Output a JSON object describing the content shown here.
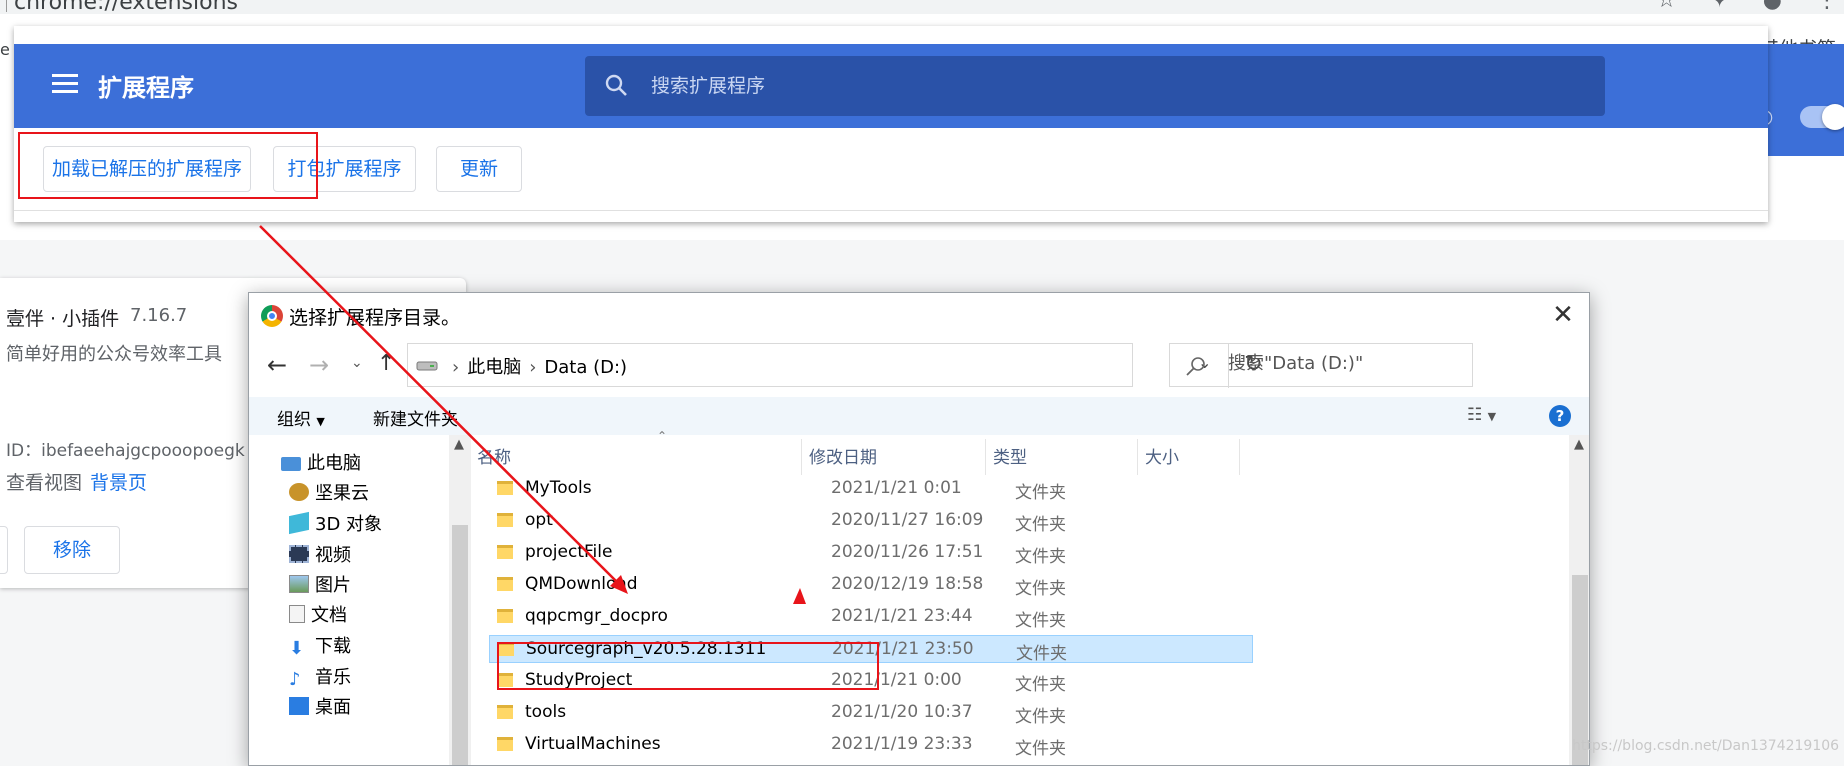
{
  "browser": {
    "url": "chrome://extensions",
    "bookmarks_other": "其他书签",
    "left_cut_text": "e"
  },
  "header": {
    "title": "扩展程序",
    "search_placeholder": "搜索扩展程序"
  },
  "toolbar": {
    "load_unpacked": "加载已解压的扩展程序",
    "pack": "打包扩展程序",
    "update": "更新"
  },
  "extension_card": {
    "name": "壹伴 · 小插件",
    "version": "7.16.7",
    "description": "简单好用的公众号效率工具",
    "id": "ID：ibefaeehajgcpooopoegk",
    "inspect_views": "查看视图",
    "background_page": "背景页",
    "remove": "移除"
  },
  "dialog": {
    "title": "选择扩展程序目录。",
    "address": {
      "crumbs": [
        "此电脑",
        "Data (D:)"
      ]
    },
    "search_placeholder": "搜索\"Data (D:)\"",
    "organize": "组织",
    "new_folder": "新建文件夹",
    "help": "?",
    "nav_pane": [
      {
        "label": "此电脑",
        "icon": "computer-icon"
      },
      {
        "label": "坚果云",
        "icon": "nutstore-icon"
      },
      {
        "label": "3D 对象",
        "icon": "3d-objects-icon"
      },
      {
        "label": "视频",
        "icon": "video-icon"
      },
      {
        "label": "图片",
        "icon": "pictures-icon"
      },
      {
        "label": "文档",
        "icon": "documents-icon"
      },
      {
        "label": "下载",
        "icon": "download-icon"
      },
      {
        "label": "音乐",
        "icon": "music-icon"
      },
      {
        "label": "桌面",
        "icon": "desktop-icon"
      }
    ],
    "columns": [
      "名称",
      "修改日期",
      "类型",
      "大小"
    ],
    "files": [
      {
        "name": "MyTools",
        "date": "2021/1/21 0:01",
        "type": "文件夹"
      },
      {
        "name": "opt",
        "date": "2020/11/27 16:09",
        "type": "文件夹"
      },
      {
        "name": "projectFile",
        "date": "2020/11/26 17:51",
        "type": "文件夹"
      },
      {
        "name": "QMDownload",
        "date": "2020/12/19 18:58",
        "type": "文件夹"
      },
      {
        "name": "qqpcmgr_docpro",
        "date": "2021/1/21 23:44",
        "type": "文件夹"
      },
      {
        "name": "Sourcegraph_v20.5.28.1311",
        "date": "2021/1/21 23:50",
        "type": "文件夹",
        "selected": true
      },
      {
        "name": "StudyProject",
        "date": "2021/1/21 0:00",
        "type": "文件夹"
      },
      {
        "name": "tools",
        "date": "2021/1/20 10:37",
        "type": "文件夹"
      },
      {
        "name": "VirtualMachines",
        "date": "2021/1/19 23:33",
        "type": "文件夹"
      }
    ]
  },
  "watermark": "https://blog.csdn.net/Dan1374219106",
  "colors": {
    "header_blue": "#3c6fd8",
    "search_blue": "#2a52a8",
    "link_blue": "#1a73e8",
    "annotation_red": "#e8141a",
    "selection_blue": "#cce8ff"
  }
}
